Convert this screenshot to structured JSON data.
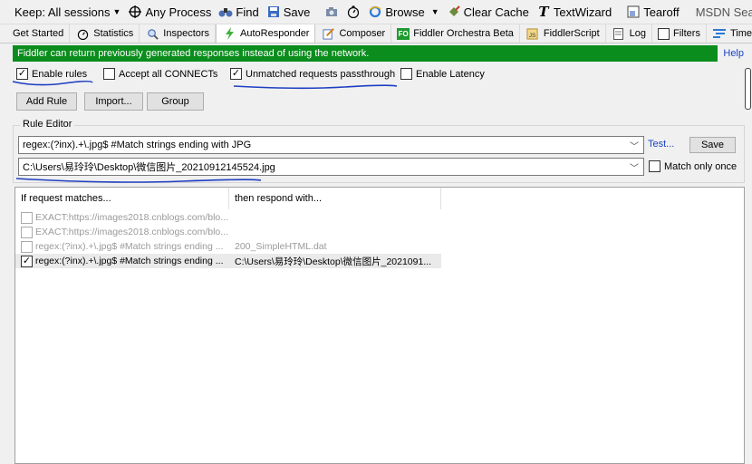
{
  "toolbar": {
    "keep": "Keep: All sessions",
    "process": "Any Process",
    "find": "Find",
    "save": "Save",
    "browse": "Browse",
    "clear_cache": "Clear Cache",
    "textwizard": "TextWizard",
    "tearoff": "Tearoff",
    "search_placeholder": "MSDN Search..."
  },
  "tabs": [
    {
      "label": "Get Started"
    },
    {
      "label": "Statistics"
    },
    {
      "label": "Inspectors"
    },
    {
      "label": "AutoResponder"
    },
    {
      "label": "Composer"
    },
    {
      "label": "Fiddler Orchestra Beta"
    },
    {
      "label": "FiddlerScript"
    },
    {
      "label": "Log"
    },
    {
      "label": "Filters"
    },
    {
      "label": "Timeline"
    }
  ],
  "banner": {
    "text": "Fiddler can return previously generated responses instead of using the network.",
    "help": "Help"
  },
  "options": {
    "enable_rules": "Enable rules",
    "accept_connects": "Accept all CONNECTs",
    "unmatched": "Unmatched requests passthrough",
    "latency": "Enable Latency"
  },
  "buttons": {
    "add_rule": "Add Rule",
    "import": "Import...",
    "group": "Group"
  },
  "editor": {
    "legend": "Rule Editor",
    "match_value": "regex:(?inx).+\\.jpg$ #Match strings ending with JPG",
    "action_value": "C:\\Users\\易玲玲\\Desktop\\微信图片_20210912145524.jpg",
    "test": "Test...",
    "save": "Save",
    "match_once": "Match only once"
  },
  "rules": {
    "col1": "If request matches...",
    "col2": "then respond with...",
    "rows": [
      {
        "match": "EXACT:https://images2018.cnblogs.com/blo...",
        "respond": ""
      },
      {
        "match": "EXACT:https://images2018.cnblogs.com/blo...",
        "respond": ""
      },
      {
        "match": "regex:(?inx).+\\.jpg$ #Match strings ending ...",
        "respond": "200_SimpleHTML.dat"
      },
      {
        "match": "regex:(?inx).+\\.jpg$ #Match strings ending ...",
        "respond": "C:\\Users\\易玲玲\\Desktop\\微信图片_2021091..."
      }
    ]
  },
  "colors": {
    "banner_bg": "#0a8d1c",
    "link": "#1a44c6",
    "annotation": "#1e3ec2"
  }
}
